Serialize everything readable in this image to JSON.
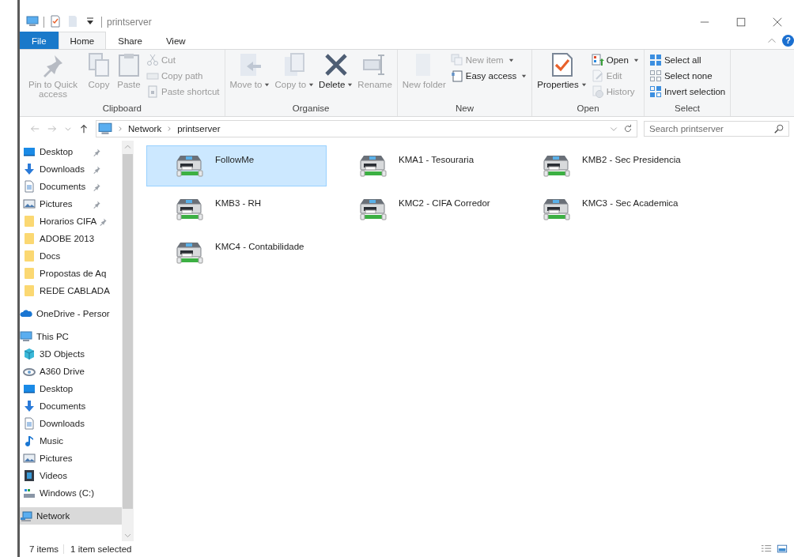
{
  "window": {
    "title": "printserver"
  },
  "help_button": {
    "label": "?"
  },
  "ribbon": {
    "tabs": [
      {
        "label": "File",
        "kind": "file",
        "selected": false
      },
      {
        "label": "Home",
        "kind": "tab",
        "selected": true
      },
      {
        "label": "Share",
        "kind": "tab",
        "selected": false
      },
      {
        "label": "View",
        "kind": "tab",
        "selected": false
      }
    ],
    "groups": [
      {
        "label": "Clipboard",
        "commands": [
          {
            "label": "Pin to Quick access",
            "kind": "large",
            "disabled": true,
            "dropdown": false
          },
          {
            "label": "Copy",
            "kind": "large",
            "disabled": true,
            "dropdown": false
          },
          {
            "label": "Paste",
            "kind": "large",
            "disabled": true,
            "dropdown": false
          },
          {
            "label": "Cut",
            "kind": "small",
            "disabled": true,
            "dropdown": false
          },
          {
            "label": "Copy path",
            "kind": "small",
            "disabled": true,
            "dropdown": false
          },
          {
            "label": "Paste shortcut",
            "kind": "small",
            "disabled": true,
            "dropdown": false
          }
        ]
      },
      {
        "label": "Organise",
        "commands": [
          {
            "label": "Move to",
            "kind": "large",
            "disabled": true,
            "dropdown": true
          },
          {
            "label": "Copy to",
            "kind": "large",
            "disabled": true,
            "dropdown": true
          },
          {
            "label": "Delete",
            "kind": "large",
            "disabled": false,
            "dropdown": true
          },
          {
            "label": "Rename",
            "kind": "large",
            "disabled": true,
            "dropdown": false
          }
        ]
      },
      {
        "label": "New",
        "commands": [
          {
            "label": "New folder",
            "kind": "large",
            "disabled": true,
            "dropdown": false
          },
          {
            "label": "New item",
            "kind": "small",
            "disabled": true,
            "dropdown": true
          },
          {
            "label": "Easy access",
            "kind": "small",
            "disabled": false,
            "dropdown": true
          }
        ]
      },
      {
        "label": "Open",
        "commands": [
          {
            "label": "Properties",
            "kind": "large",
            "disabled": false,
            "dropdown": true
          },
          {
            "label": "Open",
            "kind": "small",
            "disabled": false,
            "dropdown": true
          },
          {
            "label": "Edit",
            "kind": "small",
            "disabled": true,
            "dropdown": false
          },
          {
            "label": "History",
            "kind": "small",
            "disabled": true,
            "dropdown": false
          }
        ]
      },
      {
        "label": "Select",
        "commands": [
          {
            "label": "Select all",
            "kind": "small",
            "disabled": false,
            "dropdown": false
          },
          {
            "label": "Select none",
            "kind": "small",
            "disabled": false,
            "dropdown": false
          },
          {
            "label": "Invert selection",
            "kind": "small",
            "disabled": false,
            "dropdown": false
          }
        ]
      }
    ]
  },
  "address_bar": {
    "path": [
      "Network",
      "printserver"
    ]
  },
  "search": {
    "placeholder": "Search printserver"
  },
  "sidebar": {
    "quick_access": [
      {
        "label": "Desktop",
        "pinned": true,
        "selected": false
      },
      {
        "label": "Downloads",
        "pinned": true,
        "selected": false
      },
      {
        "label": "Documents",
        "pinned": true,
        "selected": false
      },
      {
        "label": "Pictures",
        "pinned": true,
        "selected": false
      },
      {
        "label": "Horarios CIFA",
        "pinned": true,
        "selected": false
      },
      {
        "label": "ADOBE 2013",
        "pinned": false,
        "selected": false
      },
      {
        "label": "Docs",
        "pinned": false,
        "selected": false
      },
      {
        "label": "Propostas de Aq",
        "pinned": false,
        "selected": false
      },
      {
        "label": "REDE CABLADA",
        "pinned": false,
        "selected": false
      }
    ],
    "items": [
      {
        "label": "OneDrive - Persor",
        "selected": false
      },
      {
        "label": "This PC",
        "selected": false,
        "children": [
          {
            "label": "3D Objects",
            "selected": false
          },
          {
            "label": "A360 Drive",
            "selected": false
          },
          {
            "label": "Desktop",
            "selected": false
          },
          {
            "label": "Documents",
            "selected": false
          },
          {
            "label": "Downloads",
            "selected": false
          },
          {
            "label": "Music",
            "selected": false
          },
          {
            "label": "Pictures",
            "selected": false
          },
          {
            "label": "Videos",
            "selected": false
          },
          {
            "label": "Windows (C:)",
            "selected": false
          }
        ]
      },
      {
        "label": "Network",
        "selected": true
      }
    ]
  },
  "printers": [
    {
      "name": "FollowMe",
      "selected": true
    },
    {
      "name": "KMA1 - Tesouraria",
      "selected": false
    },
    {
      "name": "KMB2 -  Sec Presidencia",
      "selected": false
    },
    {
      "name": "KMB3 - RH",
      "selected": false
    },
    {
      "name": "KMC2 - CIFA Corredor",
      "selected": false
    },
    {
      "name": "KMC3 - Sec Academica",
      "selected": false
    },
    {
      "name": "KMC4 -  Contabilidade",
      "selected": false
    }
  ],
  "status_bar": {
    "item_count": "7 items",
    "selection": "1 item selected"
  }
}
